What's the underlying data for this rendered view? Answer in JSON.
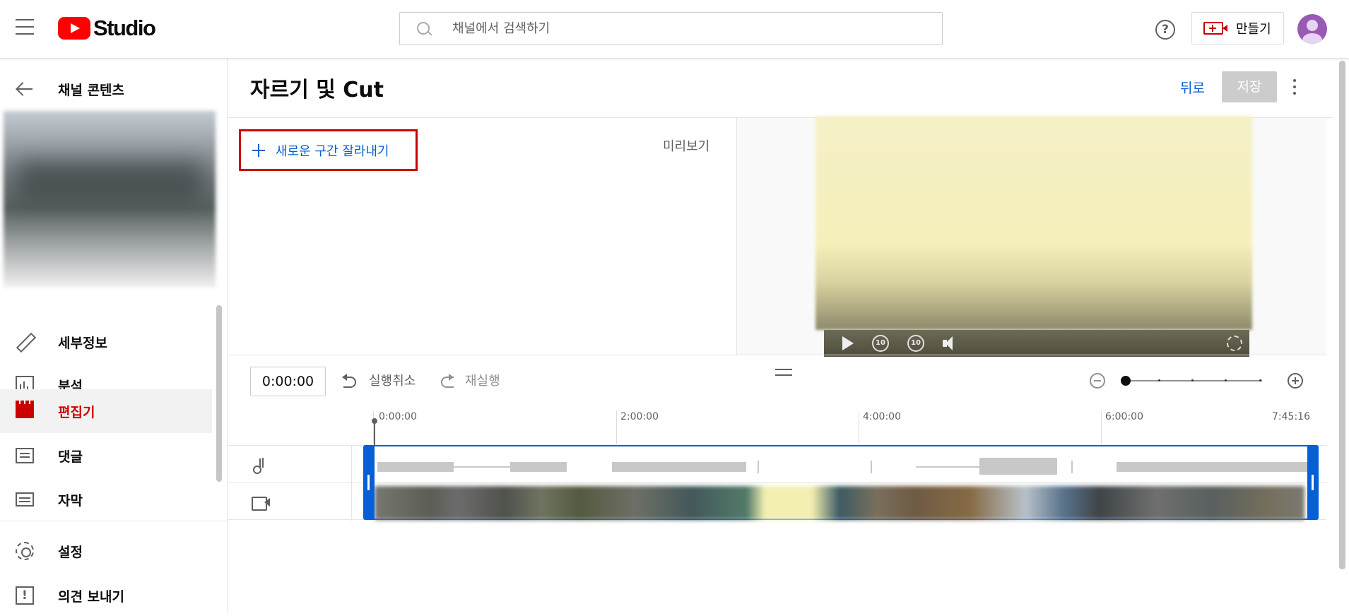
{
  "header": {
    "logo_text": "Studio",
    "search_placeholder": "채널에서 검색하기",
    "help_label": "?",
    "create_label": "만들기"
  },
  "sidebar": {
    "back_label": "채널 콘텐츠",
    "items": [
      {
        "label": "세부정보",
        "icon": "pencil-icon"
      },
      {
        "label": "분석",
        "icon": "analytics-icon"
      },
      {
        "label": "편집기",
        "icon": "editor-icon",
        "active": true
      },
      {
        "label": "댓글",
        "icon": "comments-icon"
      },
      {
        "label": "자막",
        "icon": "subtitles-icon"
      }
    ],
    "bottom_items": [
      {
        "label": "설정",
        "icon": "gear-icon"
      },
      {
        "label": "의견 보내기",
        "icon": "feedback-icon"
      }
    ]
  },
  "editor": {
    "title": "자르기 및 Cut",
    "back_label": "뒤로",
    "save_label": "저장",
    "new_cut_label": "새로운 구간 잘라내기",
    "preview_label": "미리보기",
    "timecode": "0:00:00",
    "undo_label": "실행취소",
    "redo_label": "재실행",
    "ruler": [
      "0:00:00",
      "2:00:00",
      "4:00:00",
      "6:00:00",
      "7:45:16"
    ],
    "replay_seconds": "10",
    "forward_seconds": "10"
  },
  "colors": {
    "accent_red": "#cc0000",
    "link_blue": "#065fd4",
    "youtube_red": "#ff0000"
  }
}
